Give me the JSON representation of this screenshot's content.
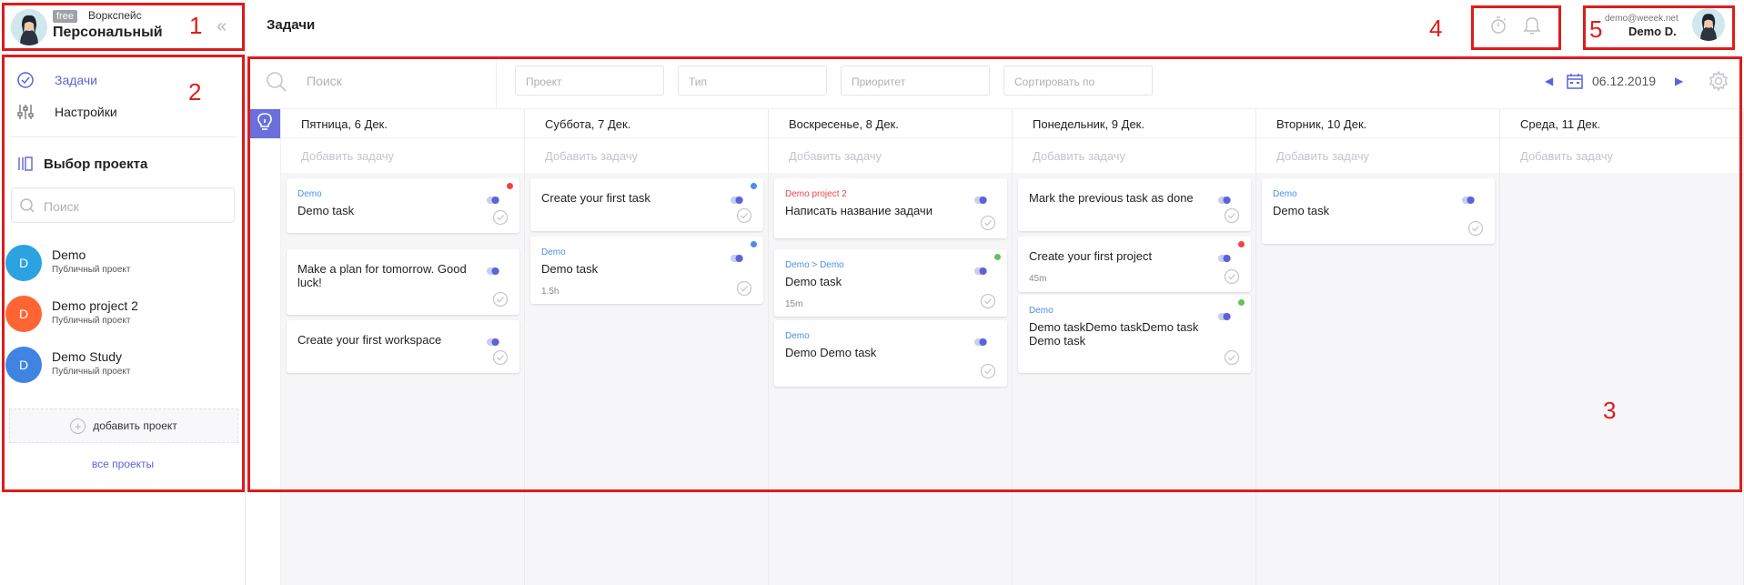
{
  "workspace": {
    "badge": "free",
    "label": "Воркспейс",
    "name": "Персональный"
  },
  "nav": {
    "tasks": "Задачи",
    "settings": "Настройки"
  },
  "projects": {
    "heading": "Выбор проекта",
    "search_placeholder": "Поиск",
    "items": [
      {
        "initial": "D",
        "name": "Demo",
        "subtitle": "Публичный проект",
        "color": "#2aa3e0"
      },
      {
        "initial": "D",
        "name": "Demo project 2",
        "subtitle": "Публичный проект",
        "color": "#ff6433"
      },
      {
        "initial": "D",
        "name": "Demo Study",
        "subtitle": "Публичный проект",
        "color": "#3f84e0"
      }
    ],
    "add_label": "добавить проект",
    "all_label": "все проекты"
  },
  "header": {
    "title": "Задачи"
  },
  "user": {
    "email": "demo@weeek.net",
    "name": "Demo D."
  },
  "filters": {
    "search_placeholder": "Поиск",
    "project": "Проект",
    "type": "Тип",
    "priority": "Приоритет",
    "sort": "Сортировать по",
    "date": "06.12.2019"
  },
  "board": {
    "add_task_label": "Добавить задачу",
    "columns": [
      {
        "title": "Пятница, 6 Дек.",
        "cards": [
          {
            "project": "Demo",
            "title": "Demo task",
            "dot": "#ef4444"
          },
          {
            "title": "Make a plan for tomorrow. Good luck!"
          },
          {
            "title": "Create your first workspace"
          }
        ]
      },
      {
        "title": "Суббота, 7 Дек.",
        "cards": [
          {
            "title": "Create your first task",
            "dot": "#4a8ee6"
          },
          {
            "project": "Demo",
            "title": "Demo task",
            "time": "1.5h",
            "dot": "#4a8ee6"
          }
        ]
      },
      {
        "title": "Воскресенье, 8 Дек.",
        "cards": [
          {
            "project": "Demo project 2",
            "project_color": "#ef4444",
            "title": "Написать название задачи"
          },
          {
            "project": "Demo > Demo",
            "title": "Demo task",
            "time": "15m",
            "dot": "#62c25a"
          },
          {
            "project": "Demo",
            "title": "Demo Demo task"
          }
        ]
      },
      {
        "title": "Понедельник, 9 Дек.",
        "cards": [
          {
            "title": "Mark the previous task as done"
          },
          {
            "title": "Create your first project",
            "time": "45m",
            "dot": "#ef4444"
          },
          {
            "project": "Demo",
            "title": "Demo taskDemo taskDemo task Demo task",
            "dot": "#62c25a"
          }
        ]
      },
      {
        "title": "Вторник, 10 Дек.",
        "cards": [
          {
            "project": "Demo",
            "title": "Demo task"
          }
        ]
      },
      {
        "title": "Среда, 11 Дек.",
        "cards": []
      }
    ]
  },
  "annotations": [
    "1",
    "2",
    "3",
    "4",
    "5"
  ],
  "colors": {
    "accent": "#5b63d8",
    "annotation": "#e01b1b"
  }
}
